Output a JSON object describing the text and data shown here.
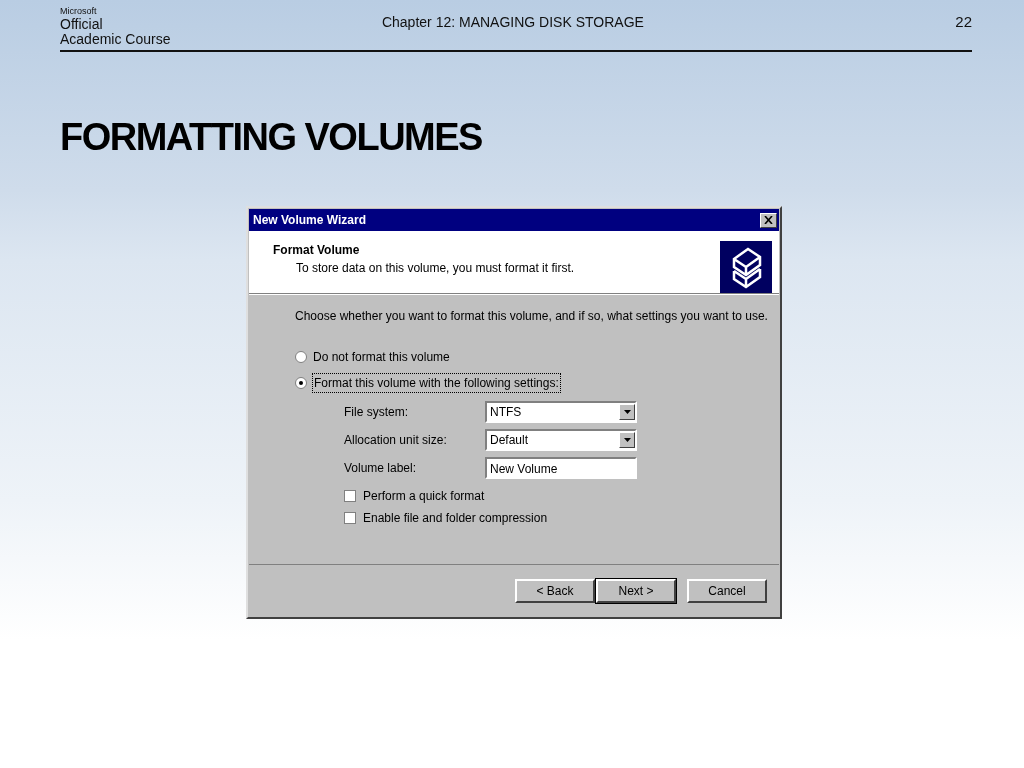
{
  "header": {
    "logo": {
      "brand": "Microsoft",
      "line_1": "Official",
      "line_2": "Academic Course"
    },
    "chapter": "Chapter 12: MANAGING DISK STORAGE",
    "page_number": "22"
  },
  "slide_title": "FORMATTING VOLUMES",
  "dialog": {
    "title": "New Volume Wizard",
    "banner": {
      "heading": "Format Volume",
      "subtitle": "To store data on this volume, you must format it first."
    },
    "prompt": "Choose whether you want to format this volume, and if so, what settings you want to use.",
    "options": [
      {
        "label": "Do not format this volume",
        "selected": false
      },
      {
        "label": "Format this volume with the following settings:",
        "selected": true
      }
    ],
    "fields": [
      {
        "kind": "dropdown",
        "label": "File system:",
        "value": "NTFS"
      },
      {
        "kind": "dropdown",
        "label": "Allocation unit size:",
        "value": "Default"
      },
      {
        "kind": "text",
        "label": "Volume label:",
        "value": "New Volume"
      }
    ],
    "checkboxes": [
      {
        "label": "Perform a quick format",
        "checked": false
      },
      {
        "label": "Enable file and folder compression",
        "checked": false
      }
    ],
    "buttons": [
      {
        "label": "< Back",
        "default": false
      },
      {
        "label": "Next >",
        "default": true
      },
      {
        "label": "Cancel",
        "default": false
      }
    ]
  }
}
